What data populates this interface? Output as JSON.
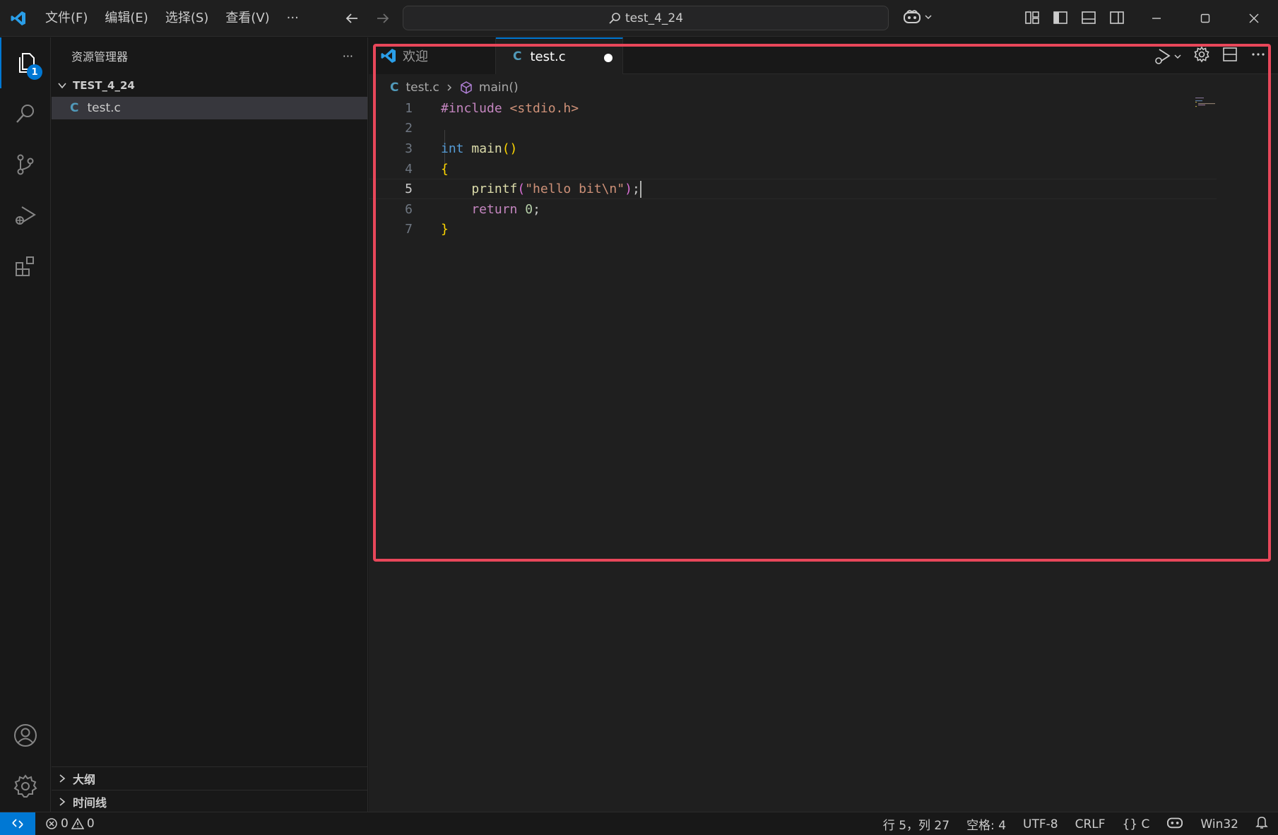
{
  "titlebar": {
    "menu": [
      "文件(F)",
      "编辑(E)",
      "选择(S)",
      "查看(V)",
      "···"
    ],
    "search": "test_4_24"
  },
  "activity": {
    "explorer_badge": "1"
  },
  "sidebar": {
    "title": "资源管理器",
    "more": "···",
    "folder": "TEST_4_24",
    "file_icon": "C",
    "file": "test.c",
    "outline": "大纲",
    "timeline": "时间线"
  },
  "editor": {
    "tabs": [
      {
        "label": "欢迎"
      },
      {
        "label": "test.c",
        "icon": "C"
      }
    ],
    "breadcrumb": {
      "file_icon": "C",
      "file": "test.c",
      "symbol": "main()"
    },
    "line_numbers": [
      "1",
      "2",
      "3",
      "4",
      "5",
      "6",
      "7"
    ],
    "code": {
      "l1_directive": "#include",
      "l1_header": " <stdio.h>",
      "l3_type": "int",
      "l3_fn": " main",
      "l3_parens": "()",
      "l4_brace": "{",
      "l5_fn": "    printf",
      "l5_open": "(",
      "l5_str": "\"hello bit\\n\"",
      "l5_close": ")",
      "l5_semi": ";",
      "l6_kw": "    return",
      "l6_num": " 0",
      "l6_semi": ";",
      "l7_brace": "}"
    }
  },
  "statusbar": {
    "errors": "0",
    "warnings": "0",
    "position": "行 5，列 27",
    "spaces": "空格: 4",
    "encoding": "UTF-8",
    "eol": "CRLF",
    "language": "{} C",
    "platform": "Win32"
  },
  "colors": {
    "accent": "#0078d4",
    "highlight": "#e8475a"
  }
}
